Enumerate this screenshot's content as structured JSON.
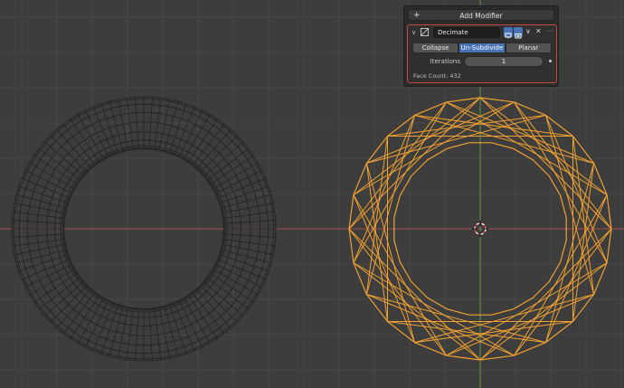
{
  "panel": {
    "add_modifier_label": "Add Modifier",
    "add_icon": "+",
    "modifier": {
      "name": "Decimate",
      "modes": [
        "Collapse",
        "Un-Subdivide",
        "Planar"
      ],
      "active_mode": "Un-Subdivide",
      "iterations_label": "Iterations",
      "iterations_value": "1",
      "face_count_text": "Face Count: 432"
    }
  },
  "icons": {
    "collapse": "chevron-down-icon",
    "modifier_type": "decimate-icon",
    "realtime": "monitor-icon",
    "render": "camera-icon",
    "dropdown": "chevron-down-icon",
    "delete": "close-icon",
    "drag": "drag-handle-icon"
  },
  "colors": {
    "background": "#3d3d3d",
    "grid": "#474747",
    "x_axis": "#a8504a",
    "y_axis": "#5b9a44",
    "wire_unselected": "#202020",
    "wire_selected": "#f0a030",
    "accent": "#4772b3",
    "modifier_border": "#c44b3c"
  }
}
